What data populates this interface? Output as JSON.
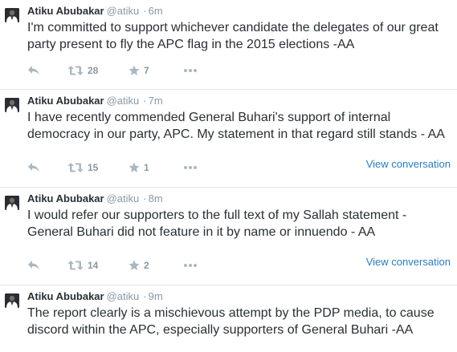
{
  "colors": {
    "text": "#292f33",
    "muted": "#8899a6",
    "icon": "#aab8c2",
    "link": "#2b7bb9",
    "divider": "#e1e8ed"
  },
  "tweets": [
    {
      "fullname": "Atiku Abubakar",
      "username": "@atiku",
      "separator": "·",
      "time": "6m",
      "text": "I'm committed to support whichever candidate the delegates of our great party present to fly the APC flag in the 2015 elections -AA",
      "retweets": "28",
      "favorites": "7",
      "view_conversation": ""
    },
    {
      "fullname": "Atiku Abubakar",
      "username": "@atiku",
      "separator": "·",
      "time": "7m",
      "text": "I have recently commended General Buhari's support of internal democracy in our party, APC. My statement in that regard still stands - AA",
      "retweets": "15",
      "favorites": "1",
      "view_conversation": "View conversation"
    },
    {
      "fullname": "Atiku Abubakar",
      "username": "@atiku",
      "separator": "·",
      "time": "8m",
      "text": "I would refer our supporters to the full text of my Sallah statement - General Buhari did not feature in it by name or innuendo - AA",
      "retweets": "14",
      "favorites": "2",
      "view_conversation": "View conversation"
    },
    {
      "fullname": "Atiku Abubakar",
      "username": "@atiku",
      "separator": "·",
      "time": "9m",
      "text": "The report clearly is a mischievous attempt by the PDP media, to cause discord within the APC, especially supporters of General Buhari -AA"
    }
  ]
}
